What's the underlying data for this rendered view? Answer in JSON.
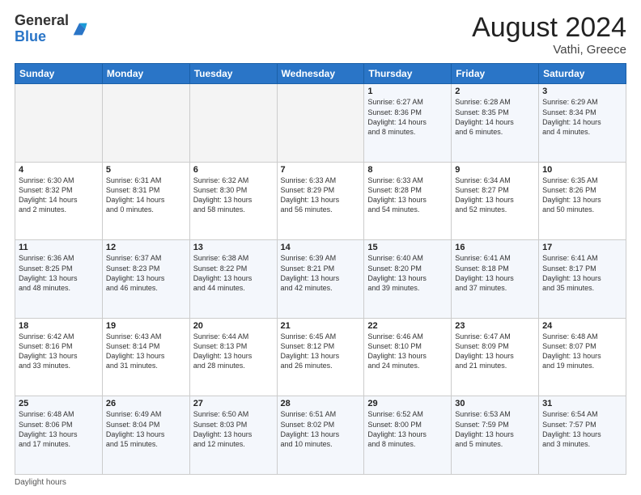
{
  "header": {
    "logo_general": "General",
    "logo_blue": "Blue",
    "month_year": "August 2024",
    "location": "Vathi, Greece"
  },
  "weekdays": [
    "Sunday",
    "Monday",
    "Tuesday",
    "Wednesday",
    "Thursday",
    "Friday",
    "Saturday"
  ],
  "weeks": [
    [
      {
        "day": "",
        "info": ""
      },
      {
        "day": "",
        "info": ""
      },
      {
        "day": "",
        "info": ""
      },
      {
        "day": "",
        "info": ""
      },
      {
        "day": "1",
        "info": "Sunrise: 6:27 AM\nSunset: 8:36 PM\nDaylight: 14 hours\nand 8 minutes."
      },
      {
        "day": "2",
        "info": "Sunrise: 6:28 AM\nSunset: 8:35 PM\nDaylight: 14 hours\nand 6 minutes."
      },
      {
        "day": "3",
        "info": "Sunrise: 6:29 AM\nSunset: 8:34 PM\nDaylight: 14 hours\nand 4 minutes."
      }
    ],
    [
      {
        "day": "4",
        "info": "Sunrise: 6:30 AM\nSunset: 8:32 PM\nDaylight: 14 hours\nand 2 minutes."
      },
      {
        "day": "5",
        "info": "Sunrise: 6:31 AM\nSunset: 8:31 PM\nDaylight: 14 hours\nand 0 minutes."
      },
      {
        "day": "6",
        "info": "Sunrise: 6:32 AM\nSunset: 8:30 PM\nDaylight: 13 hours\nand 58 minutes."
      },
      {
        "day": "7",
        "info": "Sunrise: 6:33 AM\nSunset: 8:29 PM\nDaylight: 13 hours\nand 56 minutes."
      },
      {
        "day": "8",
        "info": "Sunrise: 6:33 AM\nSunset: 8:28 PM\nDaylight: 13 hours\nand 54 minutes."
      },
      {
        "day": "9",
        "info": "Sunrise: 6:34 AM\nSunset: 8:27 PM\nDaylight: 13 hours\nand 52 minutes."
      },
      {
        "day": "10",
        "info": "Sunrise: 6:35 AM\nSunset: 8:26 PM\nDaylight: 13 hours\nand 50 minutes."
      }
    ],
    [
      {
        "day": "11",
        "info": "Sunrise: 6:36 AM\nSunset: 8:25 PM\nDaylight: 13 hours\nand 48 minutes."
      },
      {
        "day": "12",
        "info": "Sunrise: 6:37 AM\nSunset: 8:23 PM\nDaylight: 13 hours\nand 46 minutes."
      },
      {
        "day": "13",
        "info": "Sunrise: 6:38 AM\nSunset: 8:22 PM\nDaylight: 13 hours\nand 44 minutes."
      },
      {
        "day": "14",
        "info": "Sunrise: 6:39 AM\nSunset: 8:21 PM\nDaylight: 13 hours\nand 42 minutes."
      },
      {
        "day": "15",
        "info": "Sunrise: 6:40 AM\nSunset: 8:20 PM\nDaylight: 13 hours\nand 39 minutes."
      },
      {
        "day": "16",
        "info": "Sunrise: 6:41 AM\nSunset: 8:18 PM\nDaylight: 13 hours\nand 37 minutes."
      },
      {
        "day": "17",
        "info": "Sunrise: 6:41 AM\nSunset: 8:17 PM\nDaylight: 13 hours\nand 35 minutes."
      }
    ],
    [
      {
        "day": "18",
        "info": "Sunrise: 6:42 AM\nSunset: 8:16 PM\nDaylight: 13 hours\nand 33 minutes."
      },
      {
        "day": "19",
        "info": "Sunrise: 6:43 AM\nSunset: 8:14 PM\nDaylight: 13 hours\nand 31 minutes."
      },
      {
        "day": "20",
        "info": "Sunrise: 6:44 AM\nSunset: 8:13 PM\nDaylight: 13 hours\nand 28 minutes."
      },
      {
        "day": "21",
        "info": "Sunrise: 6:45 AM\nSunset: 8:12 PM\nDaylight: 13 hours\nand 26 minutes."
      },
      {
        "day": "22",
        "info": "Sunrise: 6:46 AM\nSunset: 8:10 PM\nDaylight: 13 hours\nand 24 minutes."
      },
      {
        "day": "23",
        "info": "Sunrise: 6:47 AM\nSunset: 8:09 PM\nDaylight: 13 hours\nand 21 minutes."
      },
      {
        "day": "24",
        "info": "Sunrise: 6:48 AM\nSunset: 8:07 PM\nDaylight: 13 hours\nand 19 minutes."
      }
    ],
    [
      {
        "day": "25",
        "info": "Sunrise: 6:48 AM\nSunset: 8:06 PM\nDaylight: 13 hours\nand 17 minutes."
      },
      {
        "day": "26",
        "info": "Sunrise: 6:49 AM\nSunset: 8:04 PM\nDaylight: 13 hours\nand 15 minutes."
      },
      {
        "day": "27",
        "info": "Sunrise: 6:50 AM\nSunset: 8:03 PM\nDaylight: 13 hours\nand 12 minutes."
      },
      {
        "day": "28",
        "info": "Sunrise: 6:51 AM\nSunset: 8:02 PM\nDaylight: 13 hours\nand 10 minutes."
      },
      {
        "day": "29",
        "info": "Sunrise: 6:52 AM\nSunset: 8:00 PM\nDaylight: 13 hours\nand 8 minutes."
      },
      {
        "day": "30",
        "info": "Sunrise: 6:53 AM\nSunset: 7:59 PM\nDaylight: 13 hours\nand 5 minutes."
      },
      {
        "day": "31",
        "info": "Sunrise: 6:54 AM\nSunset: 7:57 PM\nDaylight: 13 hours\nand 3 minutes."
      }
    ]
  ],
  "footer": {
    "daylight_hours": "Daylight hours"
  }
}
